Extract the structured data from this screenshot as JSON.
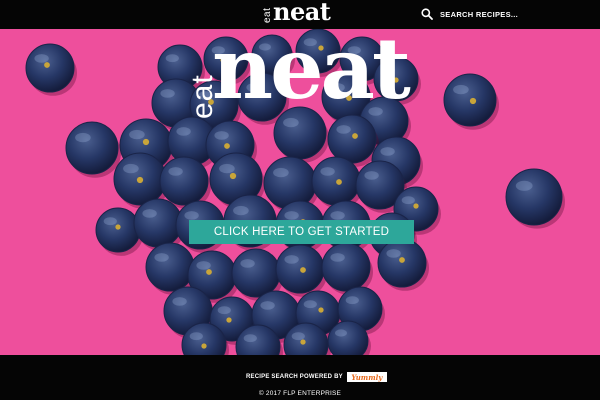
{
  "header": {
    "logo_small": "eat",
    "logo_big": "neat",
    "search_placeholder": "SEARCH RECIPES..."
  },
  "hero": {
    "logo_small": "eat",
    "logo_big": "neat",
    "cta_label": "CLICK HERE TO GET STARTED"
  },
  "footer": {
    "powered_by": "RECIPE SEARCH POWERED BY",
    "partner_logo": "Yummly",
    "copyright": "© 2017 FLP ENTERPRISE"
  },
  "colors": {
    "background_pink": "#ee4f9c",
    "cta_teal": "#2da79a",
    "bar_black": "#050505"
  }
}
